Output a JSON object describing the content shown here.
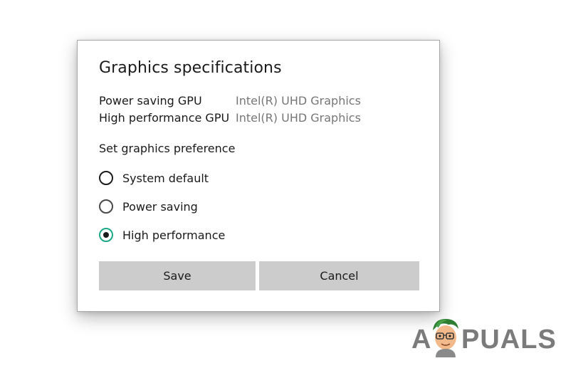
{
  "dialog": {
    "title": "Graphics specifications",
    "specs": [
      {
        "label": "Power saving GPU",
        "value": "Intel(R) UHD Graphics"
      },
      {
        "label": "High performance GPU",
        "value": "Intel(R) UHD Graphics"
      }
    ],
    "preference_label": "Set graphics preference",
    "options": [
      {
        "label": "System default",
        "selected": false
      },
      {
        "label": "Power saving",
        "selected": false
      },
      {
        "label": "High performance",
        "selected": true
      }
    ],
    "buttons": {
      "save": "Save",
      "cancel": "Cancel"
    },
    "colors": {
      "accent": "#1ea886",
      "button_bg": "#cccccc",
      "secondary_text": "#767676"
    }
  },
  "watermark": {
    "text_a": "A",
    "text_rest": "PUALS",
    "icon": "appuals-mascot-icon"
  }
}
